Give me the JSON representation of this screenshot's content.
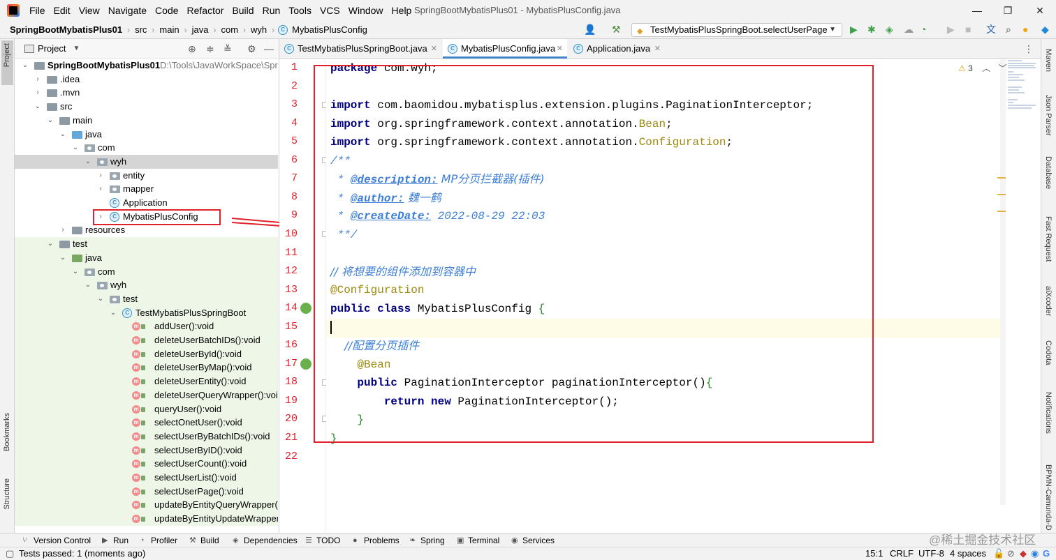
{
  "app": {
    "menu": [
      "File",
      "Edit",
      "View",
      "Navigate",
      "Code",
      "Refactor",
      "Build",
      "Run",
      "Tools",
      "VCS",
      "Window",
      "Help"
    ],
    "title": "SpringBootMybatisPlus01 - MybatisPlusConfig.java",
    "window_controls": [
      "—",
      "❐",
      "✕"
    ]
  },
  "breadcrumb": [
    "SpringBootMybatisPlus01",
    "src",
    "main",
    "java",
    "com",
    "wyh",
    "MybatisPlusConfig"
  ],
  "run_config": "TestMybatisPlusSpringBoot.selectUserPage",
  "project": {
    "title": "Project",
    "tree": [
      {
        "label": "SpringBootMybatisPlus01",
        "path": "D:\\Tools\\JavaWorkSpace\\Sprin",
        "depth": 0,
        "arrow": "down",
        "icon": "folder"
      },
      {
        "label": ".idea",
        "depth": 1,
        "arrow": "right",
        "icon": "folder"
      },
      {
        "label": ".mvn",
        "depth": 1,
        "arrow": "right",
        "icon": "folder"
      },
      {
        "label": "src",
        "depth": 1,
        "arrow": "down",
        "icon": "folder"
      },
      {
        "label": "main",
        "depth": 2,
        "arrow": "down",
        "icon": "folder"
      },
      {
        "label": "java",
        "depth": 3,
        "arrow": "down",
        "icon": "folder-blue"
      },
      {
        "label": "com",
        "depth": 4,
        "arrow": "down",
        "icon": "package"
      },
      {
        "label": "wyh",
        "depth": 5,
        "arrow": "down",
        "icon": "package",
        "selected": true
      },
      {
        "label": "entity",
        "depth": 6,
        "arrow": "right",
        "icon": "package"
      },
      {
        "label": "mapper",
        "depth": 6,
        "arrow": "right",
        "icon": "package"
      },
      {
        "label": "Application",
        "depth": 6,
        "arrow": "none",
        "icon": "class-spring"
      },
      {
        "label": "MybatisPlusConfig",
        "depth": 6,
        "arrow": "right",
        "icon": "class"
      },
      {
        "label": "resources",
        "depth": 3,
        "arrow": "right",
        "icon": "folder"
      },
      {
        "label": "test",
        "depth": 2,
        "arrow": "down",
        "icon": "folder",
        "test": true
      },
      {
        "label": "java",
        "depth": 3,
        "arrow": "down",
        "icon": "folder-green",
        "test": true
      },
      {
        "label": "com",
        "depth": 4,
        "arrow": "down",
        "icon": "package",
        "test": true
      },
      {
        "label": "wyh",
        "depth": 5,
        "arrow": "down",
        "icon": "package",
        "test": true
      },
      {
        "label": "test",
        "depth": 6,
        "arrow": "down",
        "icon": "package",
        "test": true
      },
      {
        "label": "TestMybatisPlusSpringBoot",
        "depth": 7,
        "arrow": "down",
        "icon": "class-spring",
        "test": true
      },
      {
        "label": "addUser():void",
        "depth": 9,
        "arrow": "none",
        "icon": "method",
        "test": true
      },
      {
        "label": "deleteUserBatchIDs():void",
        "depth": 9,
        "arrow": "none",
        "icon": "method",
        "test": true
      },
      {
        "label": "deleteUserById():void",
        "depth": 9,
        "arrow": "none",
        "icon": "method",
        "test": true
      },
      {
        "label": "deleteUserByMap():void",
        "depth": 9,
        "arrow": "none",
        "icon": "method",
        "test": true
      },
      {
        "label": "deleteUserEntity():void",
        "depth": 9,
        "arrow": "none",
        "icon": "method",
        "test": true
      },
      {
        "label": "deleteUserQueryWrapper():void",
        "depth": 9,
        "arrow": "none",
        "icon": "method",
        "test": true
      },
      {
        "label": "queryUser():void",
        "depth": 9,
        "arrow": "none",
        "icon": "method",
        "test": true
      },
      {
        "label": "selectOnetUser():void",
        "depth": 9,
        "arrow": "none",
        "icon": "method",
        "test": true
      },
      {
        "label": "selectUserByBatchIDs():void",
        "depth": 9,
        "arrow": "none",
        "icon": "method",
        "test": true
      },
      {
        "label": "selectUserByID():void",
        "depth": 9,
        "arrow": "none",
        "icon": "method",
        "test": true
      },
      {
        "label": "selectUserCount():void",
        "depth": 9,
        "arrow": "none",
        "icon": "method",
        "test": true
      },
      {
        "label": "selectUserList():void",
        "depth": 9,
        "arrow": "none",
        "icon": "method",
        "test": true
      },
      {
        "label": "selectUserPage():void",
        "depth": 9,
        "arrow": "none",
        "icon": "method",
        "test": true
      },
      {
        "label": "updateByEntityQueryWrapper()",
        "depth": 9,
        "arrow": "none",
        "icon": "method",
        "test": true
      },
      {
        "label": "updateByEntityUpdateWrapper",
        "depth": 9,
        "arrow": "none",
        "icon": "method",
        "test": true
      }
    ]
  },
  "editor": {
    "tabs": [
      {
        "label": "TestMybatisPlusSpringBoot.java",
        "active": false
      },
      {
        "label": "MybatisPlusConfig.java",
        "active": true
      },
      {
        "label": "Application.java",
        "active": false
      }
    ],
    "warnings": "3",
    "line_numbers": [
      "1",
      "2",
      "3",
      "4",
      "5",
      "6",
      "7",
      "8",
      "9",
      "10",
      "11",
      "12",
      "13",
      "14",
      "15",
      "16",
      "17",
      "18",
      "19",
      "20",
      "21",
      "22"
    ],
    "code": {
      "l1_kw": "package",
      "l1_rest": " com.wyh;",
      "l3_kw": "import",
      "l3_rest": " com.baomidou.mybatisplus.extension.plugins.PaginationInterceptor;",
      "l4_kw": "import",
      "l4_rest": " org.springframework.context.annotation.",
      "l4_ann": "Bean",
      "l4_end": ";",
      "l5_kw": "import",
      "l5_rest": " org.springframework.context.annotation.",
      "l5_ann": "Configuration",
      "l5_end": ";",
      "l6": "/**",
      "l7_star": " * ",
      "l7_tag": "@description:",
      "l7_text": " MP分页拦截器(插件)",
      "l8_star": " * ",
      "l8_tag": "@author:",
      "l8_text": " 魏一鹤",
      "l9_star": " * ",
      "l9_tag": "@createDate:",
      "l9_text": " 2022-08-29 22:03",
      "l10": " **/",
      "l12": "// 将想要的组件添加到容器中",
      "l13": "@Configuration",
      "l14_kw": "public class",
      "l14_rest": " MybatisPlusConfig ",
      "l14_br": "{",
      "l16": "    //配置分页插件",
      "l17": "    @Bean",
      "l18_kw": "    public",
      "l18_rest": " PaginationInterceptor paginationInterceptor()",
      "l18_br": "{",
      "l19_kw": "        return new",
      "l19_rest": " PaginationInterceptor();",
      "l20": "    }",
      "l21": "}"
    }
  },
  "left_stripe": [
    "Project",
    "Bookmarks",
    "Structure"
  ],
  "right_stripe": [
    "Maven",
    "Json Parser",
    "Database",
    "Fast Request",
    "aiXcoder",
    "Codota",
    "Notifications",
    "BPMN-Camunda-D"
  ],
  "tool_windows": [
    "Version Control",
    "Run",
    "Profiler",
    "Build",
    "Dependencies",
    "TODO",
    "Problems",
    "Spring",
    "Terminal",
    "Services"
  ],
  "watermark": "@稀土掘金技术社区",
  "status": {
    "message": "Tests passed: 1 (moments ago)",
    "position": "15:1",
    "line_sep": "CRLF",
    "encoding": "UTF-8",
    "indent": "4 spaces"
  },
  "colors": {
    "annotation_red": "#e0202a",
    "keyword": "#000080",
    "doc_blue": "#3d7fd6",
    "annotation_olive": "#9e880d"
  }
}
